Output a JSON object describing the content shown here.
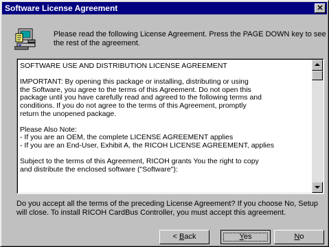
{
  "window": {
    "title": "Software License Agreement",
    "close_glyph": "✕"
  },
  "header": {
    "icon": "install-computer-icon",
    "lines": [
      "Please read the following License Agreement.  Press the PAGE DOWN key to see",
      "the rest of the agreement."
    ]
  },
  "agreement": {
    "paragraphs": [
      [
        "SOFTWARE USE AND DISTRIBUTION LICENSE AGREEMENT"
      ],
      [
        "IMPORTANT:  By opening this package or installing, distributing or using",
        "the Software, you agree to the terms of this Agreement.  Do not open this",
        "package until you have carefully read and agreed to the following terms and",
        "conditions.  If you do not agree to the terms of this Agreement, promptly",
        "return the unopened package."
      ],
      [
        "Please Also Note:",
        "- If you are an OEM, the complete LICENSE AGREEMENT applies",
        "- If you are an End-User, Exhibit A, the RICOH LICENSE AGREEMENT,  applies"
      ],
      [
        "Subject to the terms of this Agreement, RICOH grants You the right to copy",
        "and distribute the enclosed software (\"Software\"):"
      ]
    ]
  },
  "question": {
    "lines": [
      "Do you accept all the terms of the preceding License Agreement?  If you choose No,  Setup",
      "will close.  To install RICOH CardBus Controller, you must accept this agreement."
    ]
  },
  "buttons": {
    "back": {
      "prefix": "< ",
      "mnemonic": "B",
      "rest": "ack"
    },
    "yes": {
      "mnemonic": "Y",
      "rest": "es"
    },
    "no": {
      "mnemonic": "N",
      "rest": "o"
    }
  }
}
